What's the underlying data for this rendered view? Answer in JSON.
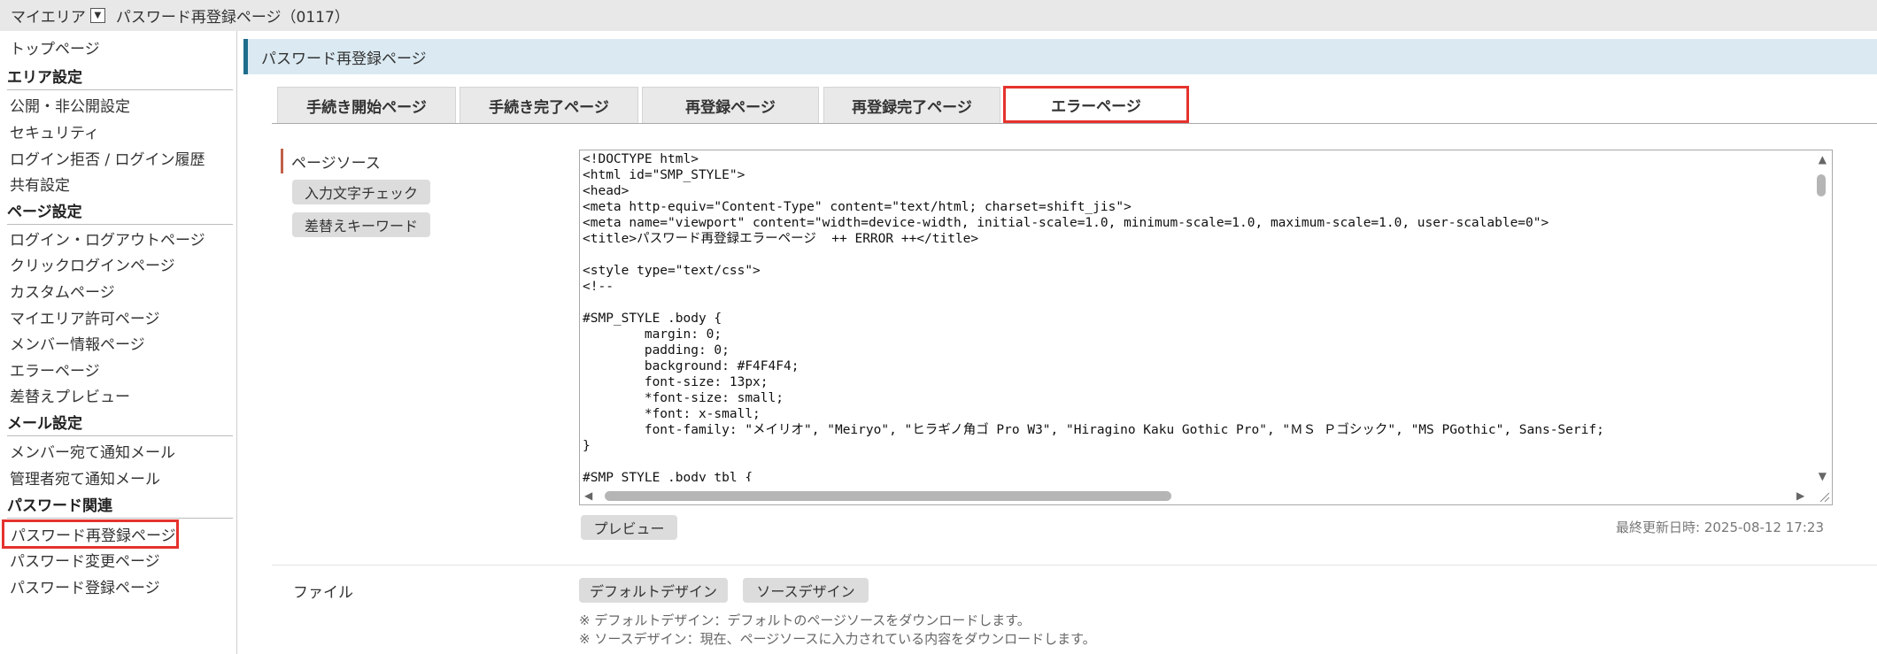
{
  "topbar": {
    "area_label": "マイエリア",
    "page_title": "パスワード再登録ページ（0117）"
  },
  "sidebar": {
    "top_page": "トップページ",
    "sections": [
      {
        "heading": "エリア設定",
        "items": [
          "公開・非公開設定",
          "セキュリティ",
          "ログイン拒否 / ログイン履歴",
          "共有設定"
        ]
      },
      {
        "heading": "ページ設定",
        "items": [
          "ログイン・ログアウトページ",
          "クリックログインページ",
          "カスタムページ",
          "マイエリア許可ページ",
          "メンバー情報ページ",
          "エラーページ",
          "差替えプレビュー"
        ]
      },
      {
        "heading": "メール設定",
        "items": [
          "メンバー宛て通知メール",
          "管理者宛て通知メール"
        ]
      },
      {
        "heading": "パスワード関連",
        "items": [
          "パスワード再登録ページ",
          "パスワード変更ページ",
          "パスワード登録ページ"
        ]
      }
    ],
    "active_item": "パスワード再登録ページ"
  },
  "main": {
    "title": "パスワード再登録ページ",
    "tabs": [
      "手続き開始ページ",
      "手続き完了ページ",
      "再登録ページ",
      "再登録完了ページ",
      "エラーページ"
    ],
    "active_tab": "エラーページ",
    "source_label": "ページソース",
    "check_button": "入力文字チェック",
    "keyword_button": "差替えキーワード",
    "code_lines": [
      "<!DOCTYPE html>",
      "<html id=\"SMP_STYLE\">",
      "<head>",
      "<meta http-equiv=\"Content-Type\" content=\"text/html; charset=shift_jis\">",
      "<meta name=\"viewport\" content=\"width=device-width, initial-scale=1.0, minimum-scale=1.0, maximum-scale=1.0, user-scalable=0\">",
      "<title>パスワード再登録エラーページ  ++ ERROR ++</title>",
      "",
      "<style type=\"text/css\">",
      "<!--",
      "",
      "#SMP_STYLE .body {",
      "        margin: 0;",
      "        padding: 0;",
      "        background: #F4F4F4;",
      "        font-size: 13px;",
      "        *font-size: small;",
      "        *font: x-small;",
      "        font-family: \"メイリオ\", \"Meiryo\", \"ヒラギノ角ゴ Pro W3\", \"Hiragino Kaku Gothic Pro\", \"ＭＳ Ｐゴシック\", \"MS PGothic\", Sans-Serif;",
      "}",
      "",
      "#SMP_STYLE .body_tbl {"
    ],
    "preview_button": "プレビュー",
    "last_updated": "最終更新日時: 2025-08-12 17:23",
    "file_label": "ファイル",
    "default_design_button": "デフォルトデザイン",
    "source_design_button": "ソースデザイン",
    "notes": [
      "※ デフォルトデザイン：デフォルトのページソースをダウンロードします。",
      "※ ソースデザイン：現在、ページソースに入力されている内容をダウンロードします。"
    ]
  },
  "colors": {
    "highlight": "#e5322d",
    "title_bar_bg": "#dbeaf2",
    "title_bar_accent": "#1f6d8c"
  }
}
